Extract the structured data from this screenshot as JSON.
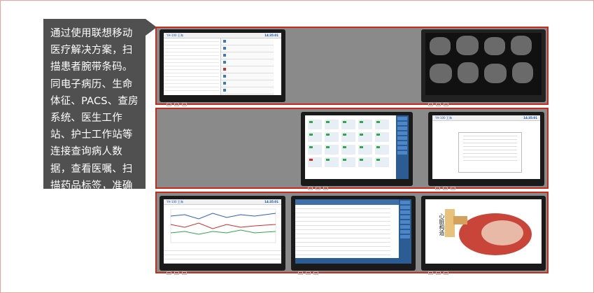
{
  "callout": {
    "text": "通过使用联想移动医疗解决方案，扫描患者腕带条码。同电子病历、生命体征、PACS、查房系统、医生工作站、护士工作站等连接查询病人数据，查看医嘱、扫描药品标签，准确无误的执行，加快效率、"
  },
  "tablets": {
    "patient_list": {
      "header_title": "YH-100 王海",
      "time": "14:35:01"
    },
    "doctor_station": {
      "header_title": "YH-100 王海",
      "time": "14:35:01"
    },
    "vitals_chart": {
      "header_title": "YH-100 王海",
      "time": "14:35:01"
    },
    "heart_model": {
      "label": "心脏构造"
    }
  },
  "colors": {
    "callout_bg": "#505050",
    "panel_border": "#c82b1c",
    "panel_bg": "#8a8a8a"
  }
}
